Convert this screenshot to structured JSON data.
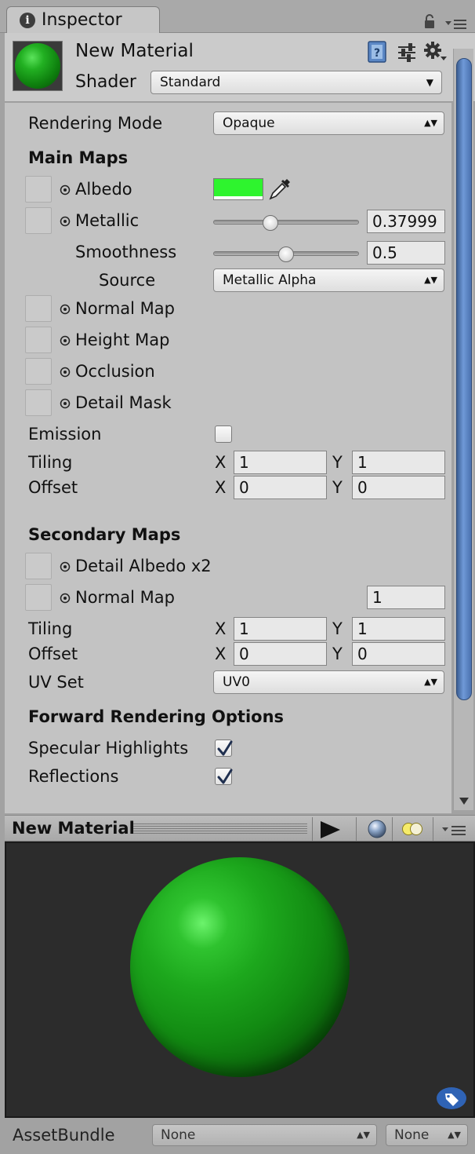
{
  "tab": {
    "title": "Inspector"
  },
  "header": {
    "material_name": "New Material",
    "shader_label": "Shader",
    "shader_value": "Standard"
  },
  "rendering_mode": {
    "label": "Rendering Mode",
    "value": "Opaque"
  },
  "main_maps": {
    "title": "Main Maps",
    "albedo": {
      "label": "Albedo",
      "color": "#2ef42e"
    },
    "metallic": {
      "label": "Metallic",
      "value": "0.37999",
      "slider": 0.38
    },
    "smoothness": {
      "label": "Smoothness",
      "value": "0.5",
      "slider": 0.5
    },
    "source": {
      "label": "Source",
      "value": "Metallic Alpha"
    },
    "normal_map": {
      "label": "Normal Map"
    },
    "height_map": {
      "label": "Height Map"
    },
    "occlusion": {
      "label": "Occlusion"
    },
    "detail_mask": {
      "label": "Detail Mask"
    },
    "emission": {
      "label": "Emission",
      "checked": false
    },
    "tiling": {
      "label": "Tiling",
      "x_label": "X",
      "x": "1",
      "y_label": "Y",
      "y": "1"
    },
    "offset": {
      "label": "Offset",
      "x_label": "X",
      "x": "0",
      "y_label": "Y",
      "y": "0"
    }
  },
  "secondary_maps": {
    "title": "Secondary Maps",
    "detail_albedo": {
      "label": "Detail Albedo x2"
    },
    "normal_map": {
      "label": "Normal Map",
      "value": "1"
    },
    "tiling": {
      "label": "Tiling",
      "x_label": "X",
      "x": "1",
      "y_label": "Y",
      "y": "1"
    },
    "offset": {
      "label": "Offset",
      "x_label": "X",
      "x": "0",
      "y_label": "Y",
      "y": "0"
    },
    "uv_set": {
      "label": "UV Set",
      "value": "UV0"
    }
  },
  "forward_rendering": {
    "title": "Forward Rendering Options",
    "specular_highlights": {
      "label": "Specular Highlights",
      "checked": true
    },
    "reflections": {
      "label": "Reflections",
      "checked": true
    }
  },
  "preview": {
    "title": "New Material"
  },
  "asset_bundle": {
    "label": "AssetBundle",
    "name": "None",
    "variant": "None"
  },
  "colors": {
    "accent": "#4a74b5",
    "albedo": "#2ef42e"
  },
  "icons": [
    "info-icon",
    "lock-icon",
    "menu-icon",
    "help-book-icon",
    "sliders-icon",
    "gear-icon",
    "eyedropper-icon",
    "object-picker-icon",
    "checkmark-icon",
    "play-icon",
    "sphere-icon",
    "lights-icon",
    "tag-icon"
  ]
}
